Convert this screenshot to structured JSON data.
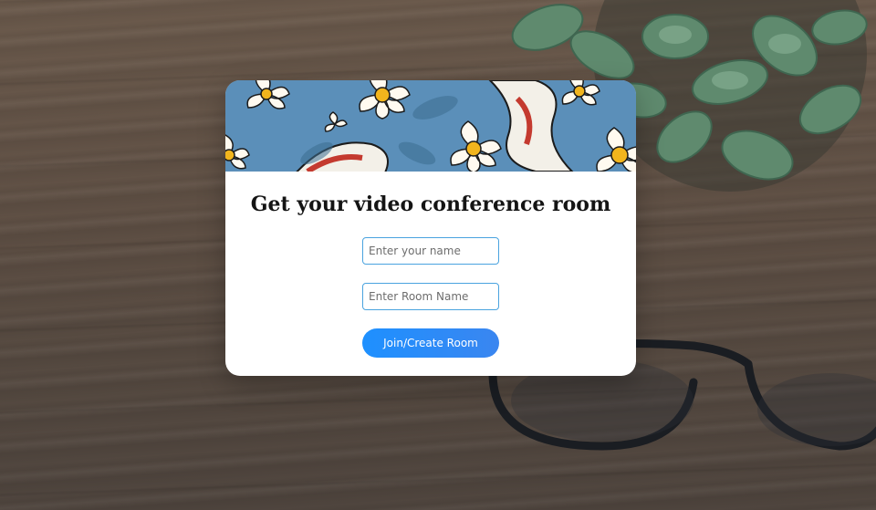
{
  "card": {
    "title": "Get your video conference room"
  },
  "form": {
    "name_placeholder": "Enter your name",
    "name_value": "",
    "room_placeholder": "Enter Room Name",
    "room_value": "",
    "submit_label": "Join/Create Room"
  },
  "colors": {
    "accent": "#1e90ff",
    "input_border": "#4aa3df",
    "banner_bg": "#5b8fb9",
    "title_text": "#141414"
  },
  "icons": {
    "background_plant": "succulent-plant",
    "background_glasses": "eyeglasses",
    "banner_art": "lotus-koi-pattern"
  }
}
